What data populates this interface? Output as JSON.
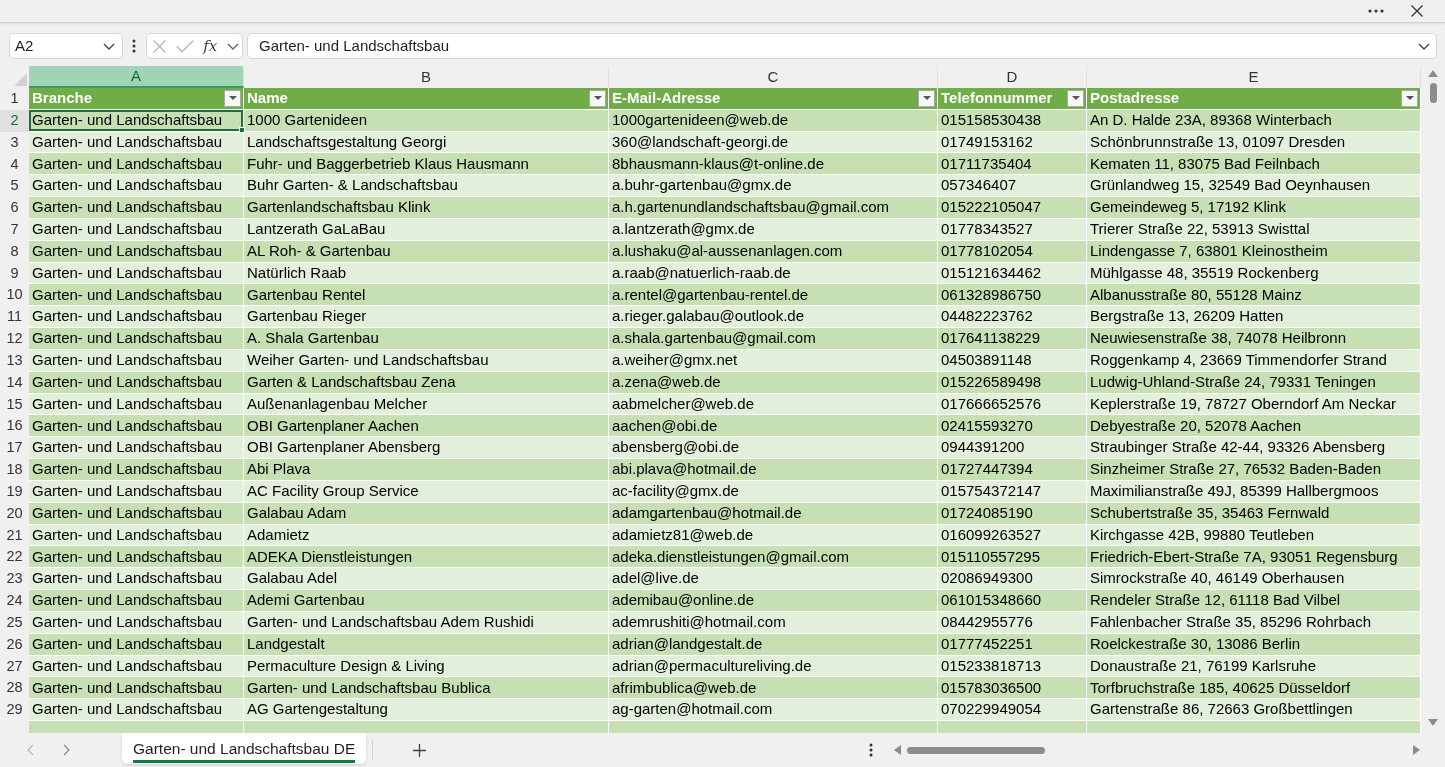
{
  "formula_bar": {
    "name_box": "A2",
    "function_label": "fx",
    "formula": "Garten- und Landschaftsbau"
  },
  "sheet": {
    "columns": [
      {
        "letter": "A",
        "selected": true
      },
      {
        "letter": "B",
        "selected": false
      },
      {
        "letter": "C",
        "selected": false
      },
      {
        "letter": "D",
        "selected": false
      },
      {
        "letter": "E",
        "selected": false
      }
    ],
    "header_row": {
      "number": "1",
      "selected": false,
      "cells": [
        "Branche",
        "Name",
        "E-Mail-Adresse",
        "Telefonnummer",
        "Postadresse"
      ]
    },
    "rows": [
      {
        "number": "2",
        "selected": true,
        "cells": [
          "Garten- und Landschaftsbau",
          "1000 Gartenideen",
          "1000gartenideen@web.de",
          "015158530438",
          "An D. Halde 23A, 89368 Winterbach"
        ]
      },
      {
        "number": "3",
        "selected": false,
        "cells": [
          "Garten- und Landschaftsbau",
          "Landschaftsgestaltung Georgi",
          "360@landschaft-georgi.de",
          "01749153162",
          "Schönbrunnstraße 13, 01097 Dresden"
        ]
      },
      {
        "number": "4",
        "selected": false,
        "cells": [
          "Garten- und Landschaftsbau",
          "Fuhr- und Baggerbetrieb Klaus Hausmann",
          "8bhausmann-klaus@t-online.de",
          "01711735404",
          "Kematen 11, 83075 Bad Feilnbach"
        ]
      },
      {
        "number": "5",
        "selected": false,
        "cells": [
          "Garten- und Landschaftsbau",
          "Buhr Garten- & Landschaftsbau",
          "a.buhr-gartenbau@gmx.de",
          "057346407",
          "Grünlandweg 15, 32549 Bad Oeynhausen"
        ]
      },
      {
        "number": "6",
        "selected": false,
        "cells": [
          "Garten- und Landschaftsbau",
          "Gartenlandschaftsbau Klink",
          "a.h.gartenundlandschaftsbau@gmail.com",
          "015222105047",
          "Gemeindeweg 5, 17192 Klink"
        ]
      },
      {
        "number": "7",
        "selected": false,
        "cells": [
          "Garten- und Landschaftsbau",
          "Lantzerath GaLaBau",
          "a.lantzerath@gmx.de",
          "01778343527",
          "Trierer Straße 22, 53913 Swisttal"
        ]
      },
      {
        "number": "8",
        "selected": false,
        "cells": [
          "Garten- und Landschaftsbau",
          "AL Roh- & Gartenbau",
          "a.lushaku@al-aussenanlagen.com",
          "01778102054",
          "Lindengasse 7, 63801 Kleinostheim"
        ]
      },
      {
        "number": "9",
        "selected": false,
        "cells": [
          "Garten- und Landschaftsbau",
          "Natürlich Raab",
          "a.raab@natuerlich-raab.de",
          "015121634462",
          "Mühlgasse 48, 35519 Rockenberg"
        ]
      },
      {
        "number": "10",
        "selected": false,
        "cells": [
          "Garten- und Landschaftsbau",
          "Gartenbau Rentel",
          "a.rentel@gartenbau-rentel.de",
          "061328986750",
          "Albanusstraße 80, 55128 Mainz"
        ]
      },
      {
        "number": "11",
        "selected": false,
        "cells": [
          "Garten- und Landschaftsbau",
          "Gartenbau Rieger",
          "a.rieger.galabau@outlook.de",
          "04482223762",
          "Bergstraße 13, 26209 Hatten"
        ]
      },
      {
        "number": "12",
        "selected": false,
        "cells": [
          "Garten- und Landschaftsbau",
          "A. Shala Gartenbau",
          "a.shala.gartenbau@gmail.com",
          "017641138229",
          "Neuwiesenstraße 38, 74078 Heilbronn"
        ]
      },
      {
        "number": "13",
        "selected": false,
        "cells": [
          "Garten- und Landschaftsbau",
          "Weiher Garten- und Landschaftsbau",
          "a.weiher@gmx.net",
          "04503891148",
          "Roggenkamp 4, 23669 Timmendorfer Strand"
        ]
      },
      {
        "number": "14",
        "selected": false,
        "cells": [
          "Garten- und Landschaftsbau",
          "Garten & Landschaftsbau Zena",
          "a.zena@web.de",
          "015226589498",
          "Ludwig-Uhland-Straße 24, 79331 Teningen"
        ]
      },
      {
        "number": "15",
        "selected": false,
        "cells": [
          "Garten- und Landschaftsbau",
          "Außenanlagenbau Melcher",
          "aabmelcher@web.de",
          "017666652576",
          "Keplerstraße 19, 78727 Oberndorf Am Neckar"
        ]
      },
      {
        "number": "16",
        "selected": false,
        "cells": [
          "Garten- und Landschaftsbau",
          "OBI Gartenplaner Aachen",
          "aachen@obi.de",
          "02415593270",
          "Debyestraße 20, 52078 Aachen"
        ]
      },
      {
        "number": "17",
        "selected": false,
        "cells": [
          "Garten- und Landschaftsbau",
          "OBI Gartenplaner Abensberg",
          "abensberg@obi.de",
          "0944391200",
          "Straubinger Straße 42-44, 93326 Abensberg"
        ]
      },
      {
        "number": "18",
        "selected": false,
        "cells": [
          "Garten- und Landschaftsbau",
          "Abi Plava",
          "abi.plava@hotmail.de",
          "01727447394",
          "Sinzheimer Straße 27, 76532 Baden-Baden"
        ]
      },
      {
        "number": "19",
        "selected": false,
        "cells": [
          "Garten- und Landschaftsbau",
          "AC Facility Group Service",
          "ac-facility@gmx.de",
          "015754372147",
          "Maximilianstraße 49J, 85399 Hallbergmoos"
        ]
      },
      {
        "number": "20",
        "selected": false,
        "cells": [
          "Garten- und Landschaftsbau",
          "Galabau Adam",
          "adamgartenbau@hotmail.de",
          "01724085190",
          "Schubertstraße 35, 35463 Fernwald"
        ]
      },
      {
        "number": "21",
        "selected": false,
        "cells": [
          "Garten- und Landschaftsbau",
          "Adamietz",
          "adamietz81@web.de",
          "016099263527",
          "Kirchgasse 42B, 99880 Teutleben"
        ]
      },
      {
        "number": "22",
        "selected": false,
        "cells": [
          "Garten- und Landschaftsbau",
          "ADEKA Dienstleistungen",
          "adeka.dienstleistungen@gmail.com",
          "015110557295",
          "Friedrich-Ebert-Straße 7A, 93051 Regensburg"
        ]
      },
      {
        "number": "23",
        "selected": false,
        "cells": [
          "Garten- und Landschaftsbau",
          "Galabau Adel",
          "adel@live.de",
          "02086949300",
          "Simrockstraße 40, 46149 Oberhausen"
        ]
      },
      {
        "number": "24",
        "selected": false,
        "cells": [
          "Garten- und Landschaftsbau",
          "Ademi Gartenbau",
          "ademibau@online.de",
          "061015348660",
          "Rendeler Straße 12, 61118 Bad Vilbel"
        ]
      },
      {
        "number": "25",
        "selected": false,
        "cells": [
          "Garten- und Landschaftsbau",
          "Garten- und Landschaftsbau Adem Rushidi",
          "ademrushiti@hotmail.com",
          "08442955776",
          "Fahlenbacher Straße 35, 85296 Rohrbach"
        ]
      },
      {
        "number": "26",
        "selected": false,
        "cells": [
          "Garten- und Landschaftsbau",
          "Landgestalt",
          "adrian@landgestalt.de",
          "01777452251",
          "Roelckestraße 30, 13086 Berlin"
        ]
      },
      {
        "number": "27",
        "selected": false,
        "cells": [
          "Garten- und Landschaftsbau",
          "Permaculture Design & Living",
          "adrian@permacultureliving.de",
          "015233818713",
          "Donaustraße 21, 76199 Karlsruhe"
        ]
      },
      {
        "number": "28",
        "selected": false,
        "cells": [
          "Garten- und Landschaftsbau",
          "Garten- und Landschaftsbau Bublica",
          "afrimbublica@web.de",
          "015783036500",
          "Torfbruchstraße 185, 40625 Düsseldorf"
        ]
      },
      {
        "number": "29",
        "selected": false,
        "cells": [
          "Garten- und Landschaftsbau",
          "AG Gartengestaltung",
          "ag-garten@hotmail.com",
          "070229949054",
          "Gartenstraße 86, 72663 Großbettlingen"
        ]
      }
    ]
  },
  "sheet_tabs": [
    {
      "label": "Garten- und Landschaftsbau DE",
      "selected": true
    }
  ]
}
